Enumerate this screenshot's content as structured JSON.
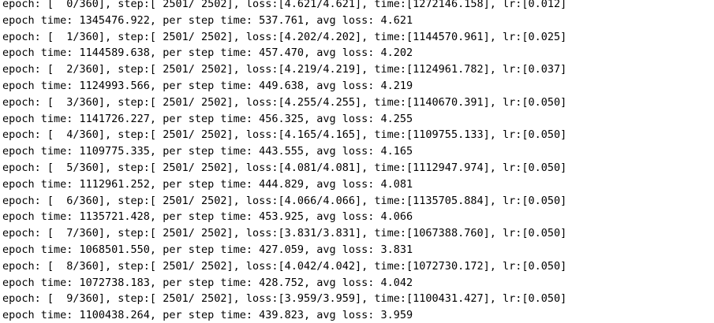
{
  "terminal": {
    "lines": [
      "epoch: [  0/360], step:[ 2501/ 2502], loss:[4.621/4.621], time:[1272146.158], lr:[0.012]",
      "epoch time: 1345476.922, per step time: 537.761, avg loss: 4.621",
      "epoch: [  1/360], step:[ 2501/ 2502], loss:[4.202/4.202], time:[1144570.961], lr:[0.025]",
      "epoch time: 1144589.638, per step time: 457.470, avg loss: 4.202",
      "epoch: [  2/360], step:[ 2501/ 2502], loss:[4.219/4.219], time:[1124961.782], lr:[0.037]",
      "epoch time: 1124993.566, per step time: 449.638, avg loss: 4.219",
      "epoch: [  3/360], step:[ 2501/ 2502], loss:[4.255/4.255], time:[1140670.391], lr:[0.050]",
      "epoch time: 1141726.227, per step time: 456.325, avg loss: 4.255",
      "epoch: [  4/360], step:[ 2501/ 2502], loss:[4.165/4.165], time:[1109755.133], lr:[0.050]",
      "epoch time: 1109775.335, per step time: 443.555, avg loss: 4.165",
      "epoch: [  5/360], step:[ 2501/ 2502], loss:[4.081/4.081], time:[1112947.974], lr:[0.050]",
      "epoch time: 1112961.252, per step time: 444.829, avg loss: 4.081",
      "epoch: [  6/360], step:[ 2501/ 2502], loss:[4.066/4.066], time:[1135705.884], lr:[0.050]",
      "epoch time: 1135721.428, per step time: 453.925, avg loss: 4.066",
      "epoch: [  7/360], step:[ 2501/ 2502], loss:[3.831/3.831], time:[1067388.760], lr:[0.050]",
      "epoch time: 1068501.550, per step time: 427.059, avg loss: 3.831",
      "epoch: [  8/360], step:[ 2501/ 2502], loss:[4.042/4.042], time:[1072730.172], lr:[0.050]",
      "epoch time: 1072738.183, per step time: 428.752, avg loss: 4.042",
      "epoch: [  9/360], step:[ 2501/ 2502], loss:[3.959/3.959], time:[1100431.427], lr:[0.050]",
      "epoch time: 1100438.264, per step time: 439.823, avg loss: 3.959"
    ]
  }
}
